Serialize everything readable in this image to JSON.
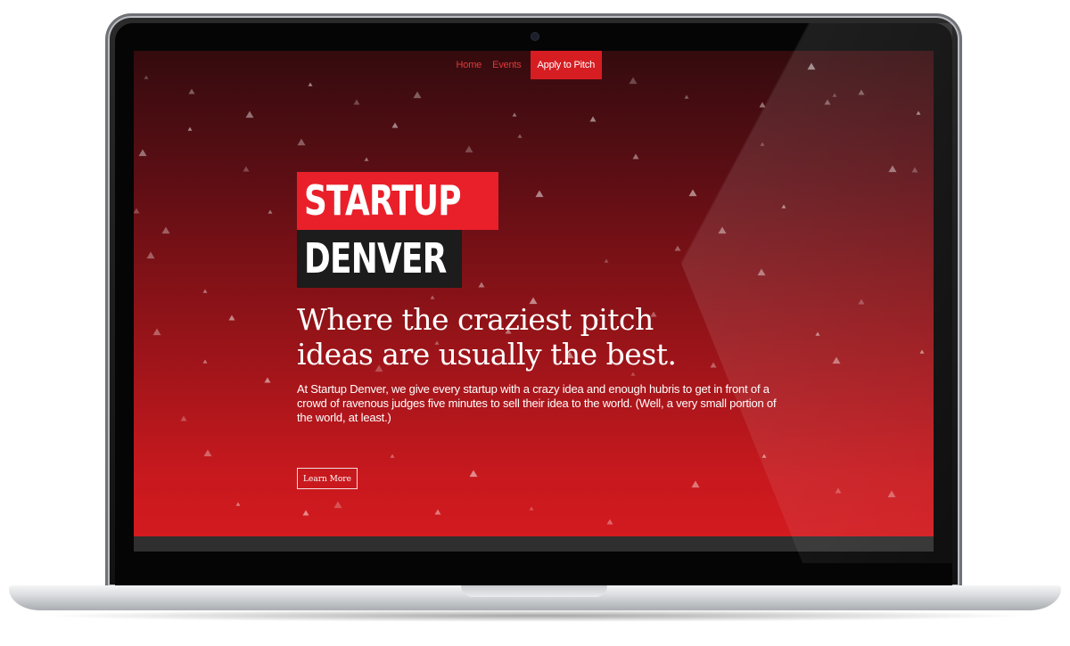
{
  "nav": {
    "items": [
      {
        "label": "Home"
      },
      {
        "label": "Events"
      }
    ],
    "cta_label": "Apply to Pitch"
  },
  "logo": {
    "line1": "STARTUP",
    "line2": "DENVER"
  },
  "hero": {
    "headline_line1": "Where the craziest pitch",
    "headline_line2": "ideas are usually the best.",
    "lead": "At Startup Denver, we give every startup with a crazy idea and enough hubris to get in front of a crowd of ravenous judges five minutes to sell their idea to the world. (Well, a very small portion of the world, at least.)",
    "button_label": "Learn More"
  },
  "colors": {
    "brand_red": "#e9202a",
    "logo_dark": "#1c1c1c",
    "nav_link": "#e03a3a",
    "hero_top": "#340b0e",
    "hero_bottom": "#d21a1f"
  }
}
